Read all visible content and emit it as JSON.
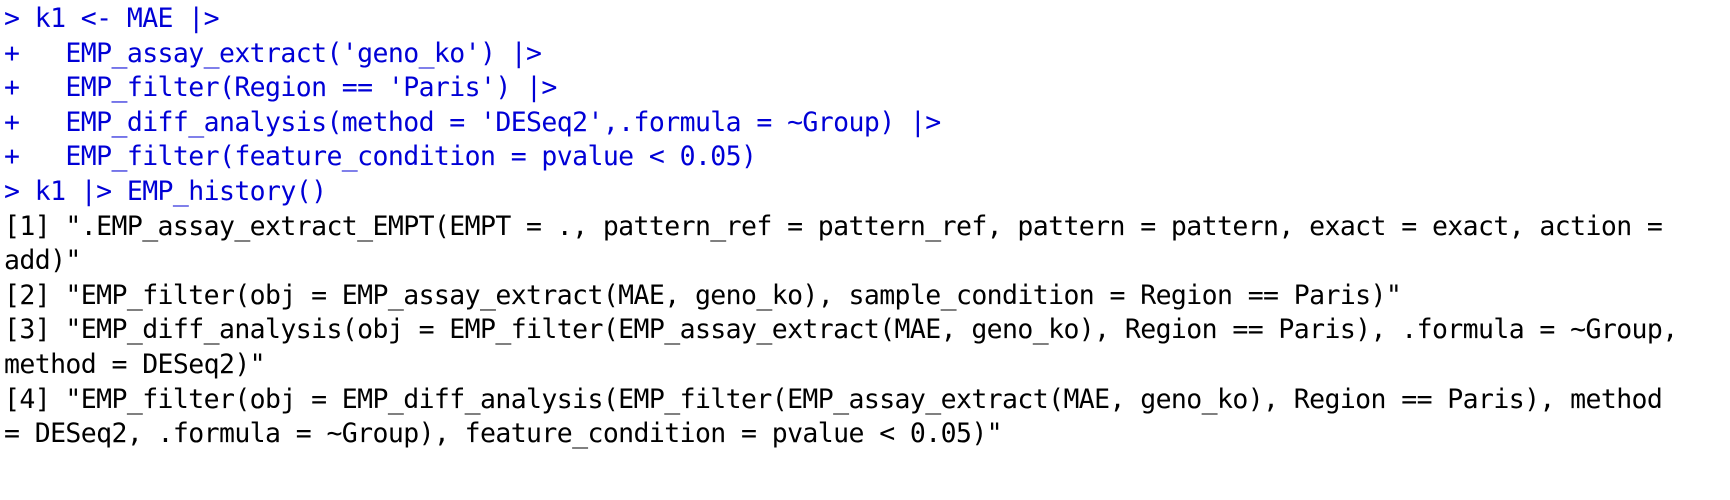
{
  "console": {
    "colors": {
      "input": "#0000d6",
      "output": "#000000",
      "background": "#ffffff"
    },
    "lines": [
      {
        "kind": "input",
        "prompt": "> ",
        "text": "k1 <- MAE |>"
      },
      {
        "kind": "input",
        "prompt": "+ ",
        "text": "  EMP_assay_extract('geno_ko') |>"
      },
      {
        "kind": "input",
        "prompt": "+ ",
        "text": "  EMP_filter(Region == 'Paris') |>"
      },
      {
        "kind": "input",
        "prompt": "+ ",
        "text": "  EMP_diff_analysis(method = 'DESeq2',.formula = ~Group) |>"
      },
      {
        "kind": "input",
        "prompt": "+ ",
        "text": "  EMP_filter(feature_condition = pvalue < 0.05)"
      },
      {
        "kind": "input",
        "prompt": "> ",
        "text": "k1 |> EMP_history()"
      },
      {
        "kind": "output",
        "prompt": "",
        "text": "[1] \".EMP_assay_extract_EMPT(EMPT = ., pattern_ref = pattern_ref, pattern = pattern, exact = exact, action ="
      },
      {
        "kind": "output",
        "prompt": "",
        "text": "add)\""
      },
      {
        "kind": "output",
        "prompt": "",
        "text": "[2] \"EMP_filter(obj = EMP_assay_extract(MAE, geno_ko), sample_condition = Region == Paris)\""
      },
      {
        "kind": "output",
        "prompt": "",
        "text": "[3] \"EMP_diff_analysis(obj = EMP_filter(EMP_assay_extract(MAE, geno_ko), Region == Paris), .formula = ~Group,"
      },
      {
        "kind": "output",
        "prompt": "",
        "text": "method = DESeq2)\""
      },
      {
        "kind": "output",
        "prompt": "",
        "text": "[4] \"EMP_filter(obj = EMP_diff_analysis(EMP_filter(EMP_assay_extract(MAE, geno_ko), Region == Paris), method"
      },
      {
        "kind": "output",
        "prompt": "",
        "text": "= DESeq2, .formula = ~Group), feature_condition = pvalue < 0.05)\""
      }
    ]
  }
}
